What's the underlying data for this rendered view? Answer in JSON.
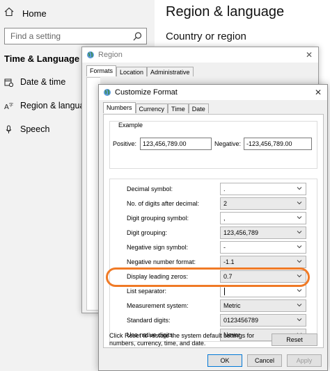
{
  "settings": {
    "home_label": "Home",
    "search_placeholder": "Find a setting",
    "section_title": "Time & Language",
    "nav_items": [
      {
        "label": "Date & time",
        "icon": "calendar-clock-icon"
      },
      {
        "label": "Region & language",
        "icon": "language-icon"
      },
      {
        "label": "Speech",
        "icon": "microphone-icon"
      }
    ],
    "page_title": "Region & language",
    "subtitle": "Country or region"
  },
  "region_dialog": {
    "title": "Region",
    "tabs": [
      "Formats",
      "Location",
      "Administrative"
    ]
  },
  "customize": {
    "title": "Customize Format",
    "tabs": [
      "Numbers",
      "Currency",
      "Time",
      "Date"
    ],
    "example_label": "Example",
    "positive_label": "Positive:",
    "positive_value": "123,456,789.00",
    "negative_label": "Negative:",
    "negative_value": "-123,456,789.00",
    "rows": [
      {
        "label": "Decimal symbol:",
        "value": "."
      },
      {
        "label": "No. of digits after decimal:",
        "value": "2"
      },
      {
        "label": "Digit grouping symbol:",
        "value": ","
      },
      {
        "label": "Digit grouping:",
        "value": "123,456,789"
      },
      {
        "label": "Negative sign symbol:",
        "value": "-"
      },
      {
        "label": "Negative number format:",
        "value": "-1.1"
      },
      {
        "label": "Display leading zeros:",
        "value": "0.7"
      },
      {
        "label": "List separator:",
        "value": ""
      },
      {
        "label": "Measurement system:",
        "value": "Metric"
      },
      {
        "label": "Standard digits:",
        "value": "0123456789"
      },
      {
        "label": "Use native digits:",
        "value": "Never"
      }
    ],
    "reset_note": "Click Reset to restore the system default settings for numbers, currency, time, and date.",
    "reset_button": "Reset",
    "ok_button": "OK",
    "cancel_button": "Cancel",
    "apply_button": "Apply"
  },
  "colors": {
    "highlight_ring": "#f07a26",
    "sidebar_bg": "#f2f2f2",
    "dialog_bg": "#f0f0f0"
  }
}
